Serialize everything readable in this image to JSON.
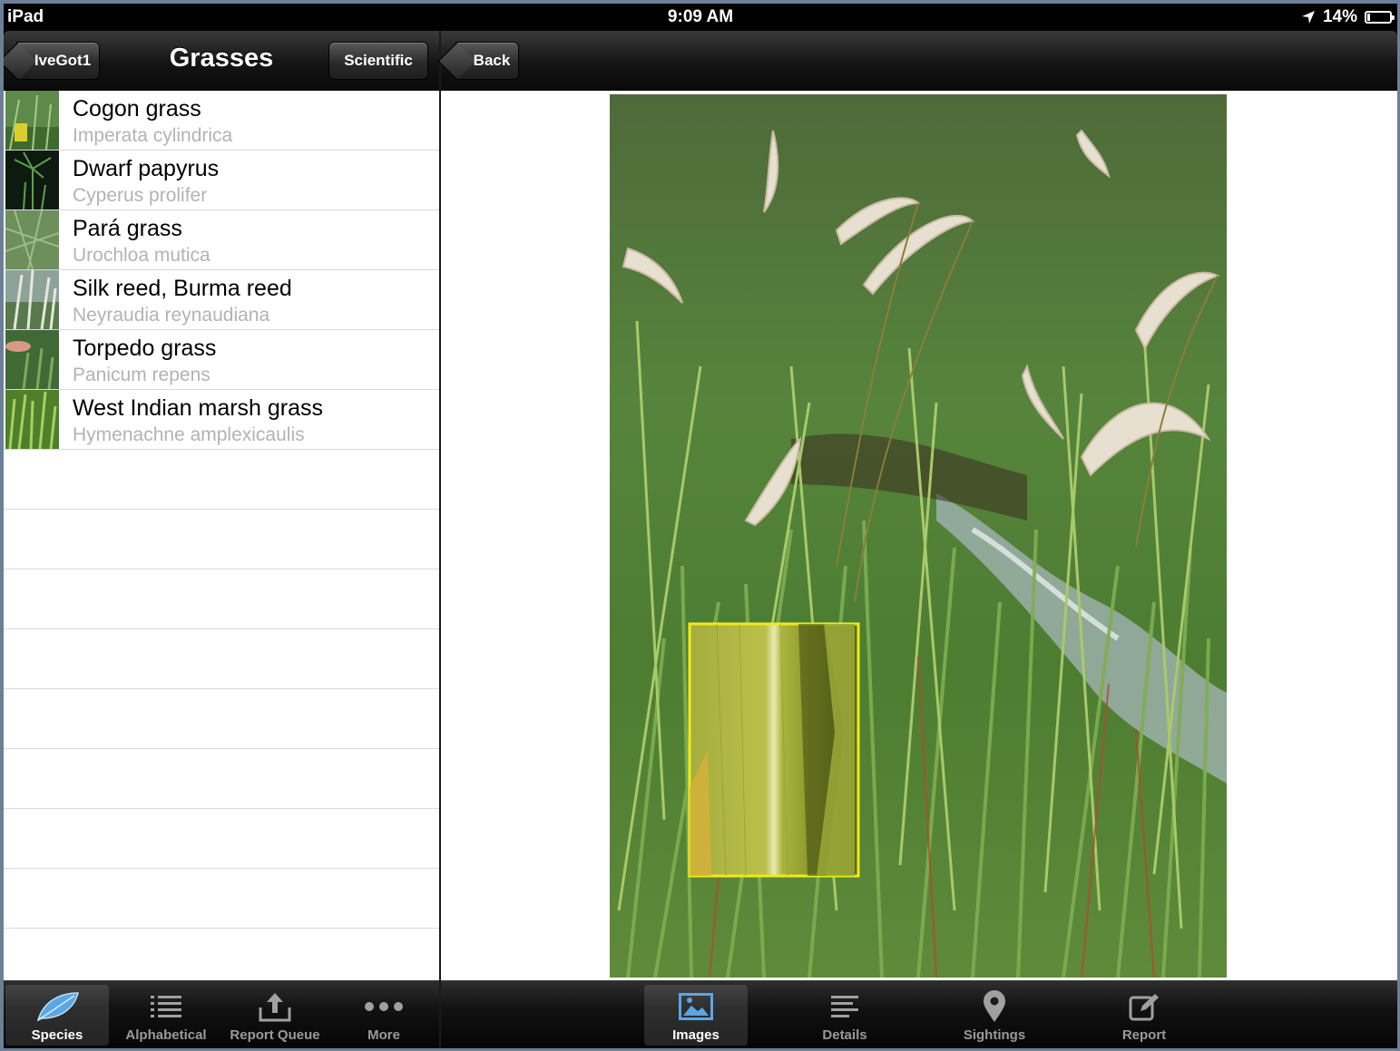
{
  "status": {
    "device": "iPad",
    "time": "9:09 AM",
    "battery": "14%",
    "battery_level": 0.14
  },
  "left_nav": {
    "back_label": "IveGot1",
    "title": "Grasses",
    "toggle_label": "Scientific"
  },
  "right_nav": {
    "back_label": "Back"
  },
  "species": [
    {
      "common": "Cogon grass",
      "scientific": "Imperata cylindrica"
    },
    {
      "common": "Dwarf papyrus",
      "scientific": "Cyperus prolifer"
    },
    {
      "common": "Pará grass",
      "scientific": "Urochloa mutica"
    },
    {
      "common": "Silk reed, Burma reed",
      "scientific": "Neyraudia reynaudiana"
    },
    {
      "common": "Torpedo grass",
      "scientific": "Panicum repens"
    },
    {
      "common": "West Indian marsh grass",
      "scientific": "Hymenachne amplexicaulis"
    }
  ],
  "left_tabs": [
    {
      "label": "Species",
      "icon": "leaf-icon",
      "active": true
    },
    {
      "label": "Alphabetical",
      "icon": "list-icon",
      "active": false
    },
    {
      "label": "Report Queue",
      "icon": "upload-icon",
      "active": false
    },
    {
      "label": "More",
      "icon": "more-icon",
      "active": false
    }
  ],
  "right_tabs": [
    {
      "label": "Images",
      "icon": "image-icon",
      "active": true
    },
    {
      "label": "Details",
      "icon": "details-icon",
      "active": false
    },
    {
      "label": "Sightings",
      "icon": "pin-icon",
      "active": false
    },
    {
      "label": "Report",
      "icon": "compose-icon",
      "active": false
    }
  ],
  "colors": {
    "accent_blue": "#5aa7e6",
    "inset_border": "#e8e000",
    "grass_green": "#4f7f35"
  }
}
